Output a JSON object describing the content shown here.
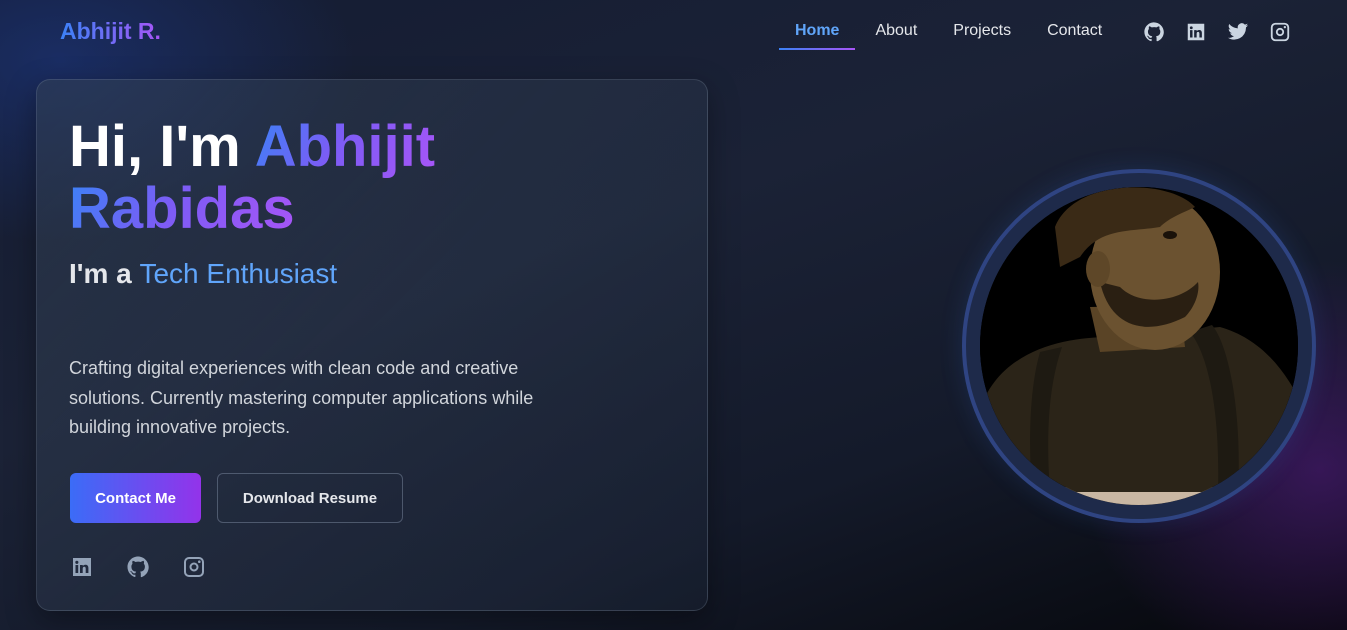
{
  "nav": {
    "logo": "Abhijit R.",
    "links": [
      {
        "label": "Home",
        "active": true
      },
      {
        "label": "About",
        "active": false
      },
      {
        "label": "Projects",
        "active": false
      },
      {
        "label": "Contact",
        "active": false
      }
    ],
    "social_icons": [
      "github-icon",
      "linkedin-icon",
      "twitter-icon",
      "instagram-icon"
    ]
  },
  "hero": {
    "greeting": "Hi, I'm",
    "first_name": "Abhijit",
    "last_name": "Rabidas",
    "subtitle_prefix": "I'm a",
    "role": "Tech Enthusiast",
    "description": "Crafting digital experiences with clean code and creative solutions. Currently mastering computer applications while building innovative projects.",
    "primary_button": "Contact Me",
    "secondary_button": "Download Resume",
    "social_icons": [
      "linkedin-icon",
      "github-icon",
      "instagram-icon"
    ]
  },
  "colors": {
    "accent_blue": "#3b82f6",
    "accent_purple": "#a855f7",
    "background": "#141c33"
  }
}
